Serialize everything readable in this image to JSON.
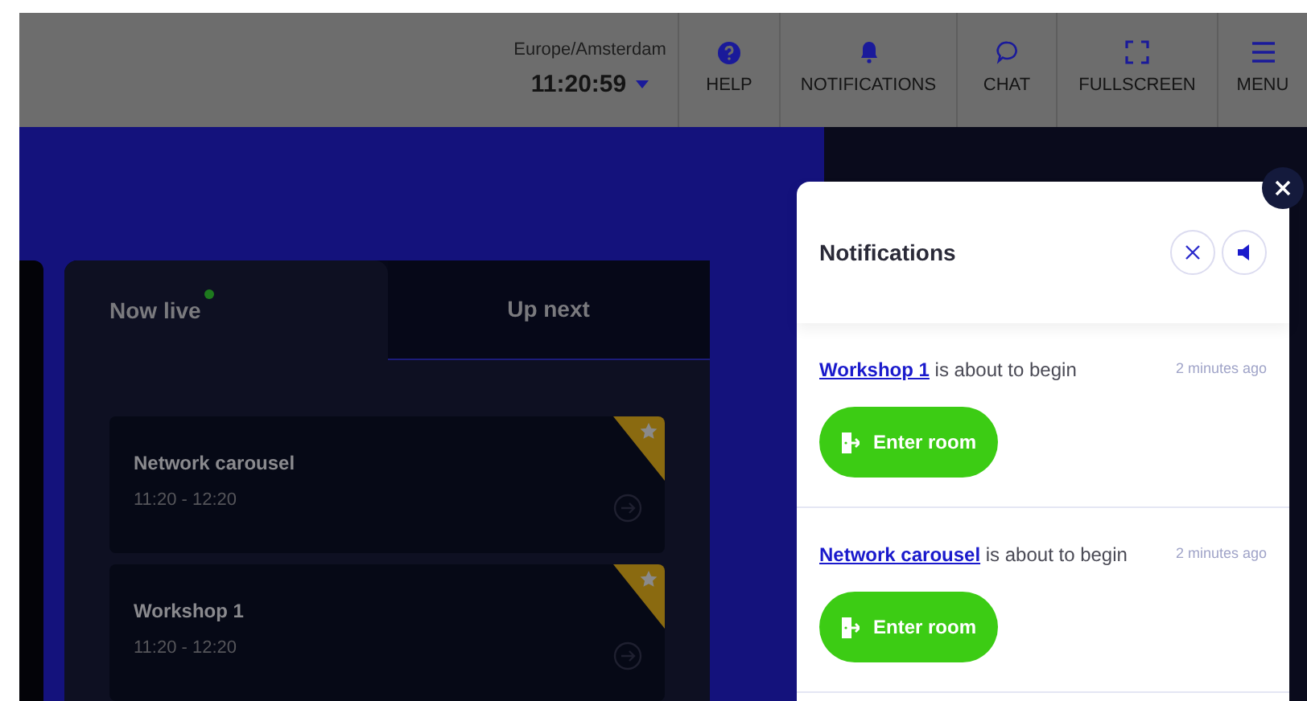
{
  "header": {
    "timezone": "Europe/Amsterdam",
    "time": "11:20:59",
    "nav_items": [
      {
        "label": "HELP"
      },
      {
        "label": "NOTIFICATIONS"
      },
      {
        "label": "CHAT"
      },
      {
        "label": "FULLSCREEN"
      },
      {
        "label": "MENU"
      }
    ]
  },
  "schedule": {
    "tabs": [
      {
        "label": "Now live",
        "selected": true,
        "live": true
      },
      {
        "label": "Up next",
        "selected": false,
        "live": false
      }
    ],
    "sessions": [
      {
        "title": "Network carousel",
        "time": "11:20 - 12:20",
        "favorite": true
      },
      {
        "title": "Workshop 1",
        "time": "11:20 - 12:20",
        "favorite": true
      }
    ]
  },
  "notifications": {
    "title": "Notifications",
    "items": [
      {
        "link": "Workshop 1",
        "text": " is about to begin",
        "time": "2 minutes ago",
        "button": "Enter room"
      },
      {
        "link": "Network carousel",
        "text": " is about to begin",
        "time": "2 minutes ago",
        "button": "Enter room"
      }
    ]
  }
}
